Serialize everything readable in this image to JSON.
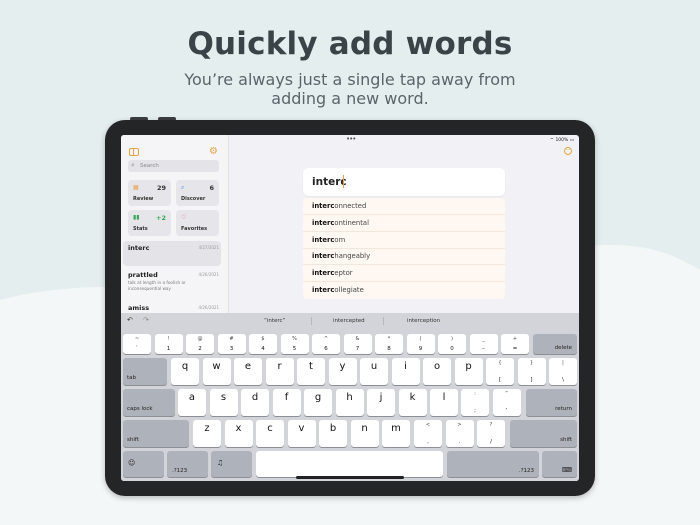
{
  "headline": {
    "title": "Quickly add words",
    "subtitle_line1": "You’re always just a single tap away from",
    "subtitle_line2": "adding a new word."
  },
  "status_bar": {
    "time": "9:48 AM  Fri Jan 28",
    "battery": "100%"
  },
  "sidebar": {
    "search_placeholder": "Search",
    "cards": [
      {
        "label": "Review",
        "count": "29",
        "icon": "calendar-icon",
        "color": "#e8a24a"
      },
      {
        "label": "Discover",
        "count": "6",
        "icon": "magnifier-icon",
        "color": "#4a90e2"
      },
      {
        "label": "Stats",
        "count": "+2",
        "icon": "bar-chart-icon",
        "color": "#3aa655"
      },
      {
        "label": "Favorites",
        "count": "",
        "icon": "heart-icon",
        "color": "#e25555"
      }
    ],
    "words": [
      {
        "word": "interc",
        "date": "4/27/2021",
        "definition": ""
      },
      {
        "word": "prattled",
        "date": "4/26/2021",
        "definition": "talk at length in a foolish or inconsequential way"
      },
      {
        "word": "amiss",
        "date": "4/26/2021",
        "definition": ""
      }
    ]
  },
  "editor": {
    "input_value": "interc",
    "suggestions": [
      {
        "match": "interc",
        "rest": "onnected"
      },
      {
        "match": "interc",
        "rest": "ontinental"
      },
      {
        "match": "interc",
        "rest": "om"
      },
      {
        "match": "interc",
        "rest": "hangeably"
      },
      {
        "match": "interc",
        "rest": "eptor"
      },
      {
        "match": "interc",
        "rest": "ollegiate"
      }
    ]
  },
  "keyboard": {
    "quicktype": [
      "“interc”",
      "intercepted",
      "interception"
    ],
    "row_numbers": [
      {
        "top": "~",
        "bottom": "`"
      },
      {
        "top": "!",
        "bottom": "1"
      },
      {
        "top": "@",
        "bottom": "2"
      },
      {
        "top": "#",
        "bottom": "3"
      },
      {
        "top": "$",
        "bottom": "4"
      },
      {
        "top": "%",
        "bottom": "5"
      },
      {
        "top": "^",
        "bottom": "6"
      },
      {
        "top": "&",
        "bottom": "7"
      },
      {
        "top": "*",
        "bottom": "8"
      },
      {
        "top": "(",
        "bottom": "9"
      },
      {
        "top": ")",
        "bottom": "0"
      },
      {
        "top": "_",
        "bottom": "–"
      },
      {
        "top": "+",
        "bottom": "="
      }
    ],
    "delete": "delete",
    "tab": "tab",
    "row_q": [
      "q",
      "w",
      "e",
      "r",
      "t",
      "y",
      "u",
      "i",
      "o",
      "p"
    ],
    "row_q_extra": [
      {
        "top": "{",
        "bottom": "["
      },
      {
        "top": "}",
        "bottom": "]"
      },
      {
        "top": "|",
        "bottom": "\\"
      }
    ],
    "caps_lock": "caps lock",
    "row_a": [
      "a",
      "s",
      "d",
      "f",
      "g",
      "h",
      "j",
      "k",
      "l"
    ],
    "row_a_extra": [
      {
        "top": ":",
        "bottom": ";"
      },
      {
        "top": "”",
        "bottom": "’"
      }
    ],
    "return": "return",
    "shift": "shift",
    "row_z": [
      "z",
      "x",
      "c",
      "v",
      "b",
      "n",
      "m"
    ],
    "row_z_extra": [
      {
        "top": "<",
        "bottom": ","
      },
      {
        "top": ">",
        "bottom": "."
      },
      {
        "top": "?",
        "bottom": "/"
      }
    ],
    "numbers_key": ".?123"
  }
}
